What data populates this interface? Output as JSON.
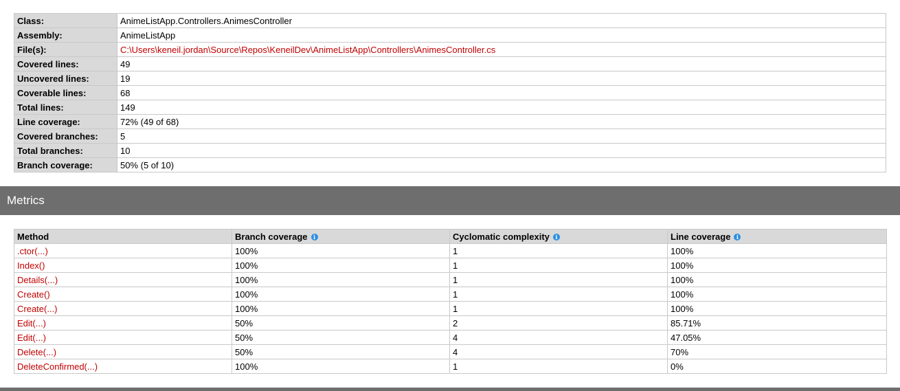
{
  "overview": [
    {
      "label": "Class:",
      "value": "AnimeListApp.Controllers.AnimesController",
      "link": false
    },
    {
      "label": "Assembly:",
      "value": "AnimeListApp",
      "link": false
    },
    {
      "label": "File(s):",
      "value": "C:\\Users\\keneil.jordan\\Source\\Repos\\KeneilDev\\AnimeListApp\\Controllers\\AnimesController.cs",
      "link": true
    },
    {
      "label": "Covered lines:",
      "value": "49",
      "link": false
    },
    {
      "label": "Uncovered lines:",
      "value": "19",
      "link": false
    },
    {
      "label": "Coverable lines:",
      "value": "68",
      "link": false
    },
    {
      "label": "Total lines:",
      "value": "149",
      "link": false
    },
    {
      "label": "Line coverage:",
      "value": "72% (49 of 68)",
      "link": false
    },
    {
      "label": "Covered branches:",
      "value": "5",
      "link": false
    },
    {
      "label": "Total branches:",
      "value": "10",
      "link": false
    },
    {
      "label": "Branch coverage:",
      "value": "50% (5 of 10)",
      "link": false
    }
  ],
  "metrics": {
    "title": "Metrics",
    "info_icon": "info-icon",
    "columns": [
      "Method",
      "Branch coverage",
      "Cyclomatic complexity",
      "Line coverage"
    ],
    "rows": [
      {
        "method": ".ctor(...)",
        "branch": "100%",
        "complexity": "1",
        "line": "100%"
      },
      {
        "method": "Index()",
        "branch": "100%",
        "complexity": "1",
        "line": "100%"
      },
      {
        "method": "Details(...)",
        "branch": "100%",
        "complexity": "1",
        "line": "100%"
      },
      {
        "method": "Create()",
        "branch": "100%",
        "complexity": "1",
        "line": "100%"
      },
      {
        "method": "Create(...)",
        "branch": "100%",
        "complexity": "1",
        "line": "100%"
      },
      {
        "method": "Edit(...)",
        "branch": "50%",
        "complexity": "2",
        "line": "85.71%"
      },
      {
        "method": "Edit(...)",
        "branch": "50%",
        "complexity": "4",
        "line": "47.05%"
      },
      {
        "method": "Delete(...)",
        "branch": "50%",
        "complexity": "4",
        "line": "70%"
      },
      {
        "method": "DeleteConfirmed(...)",
        "branch": "100%",
        "complexity": "1",
        "line": "0%"
      }
    ]
  },
  "colors": {
    "link": "#c00000",
    "header_bar": "#6e6e6e",
    "table_header": "#d9d9d9",
    "info_icon": "#2b8fe3"
  }
}
